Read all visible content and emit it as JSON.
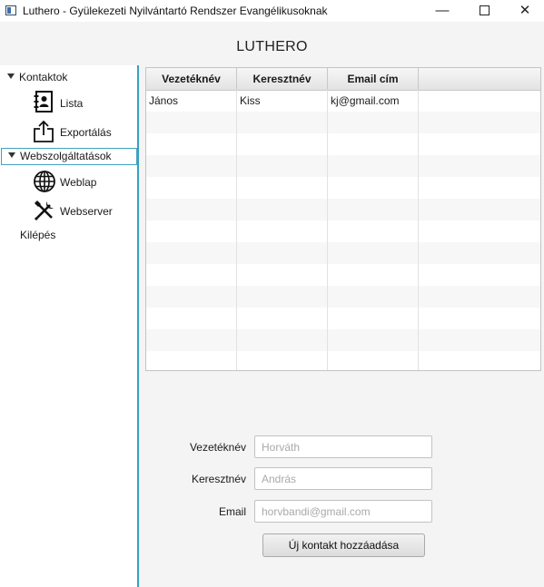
{
  "window": {
    "title": "Luthero - Gyülekezeti Nyilvántartó Rendszer Evangélikusoknak",
    "min_glyph": "—",
    "close_glyph": "✕"
  },
  "header": {
    "title": "LUTHERO"
  },
  "sidebar": {
    "groups": [
      {
        "label": "Kontaktok",
        "selected": false,
        "items": [
          {
            "label": "Lista",
            "icon": "address-book-icon"
          },
          {
            "label": "Exportálás",
            "icon": "export-icon"
          }
        ]
      },
      {
        "label": "Webszolgáltatások",
        "selected": true,
        "items": [
          {
            "label": "Weblap",
            "icon": "globe-icon"
          },
          {
            "label": "Webserver",
            "icon": "tools-icon"
          }
        ]
      }
    ],
    "exit_label": "Kilépés"
  },
  "table": {
    "columns": [
      "Vezetéknév",
      "Keresztnév",
      "Email cím"
    ],
    "rows": [
      [
        "János",
        "Kiss",
        "kj@gmail.com"
      ]
    ]
  },
  "form": {
    "lastname": {
      "label": "Vezetéknév",
      "placeholder": "Horváth",
      "value": ""
    },
    "firstname": {
      "label": "Keresztnév",
      "placeholder": "András",
      "value": ""
    },
    "email": {
      "label": "Email",
      "placeholder": "horvbandi@gmail.com",
      "value": ""
    },
    "submit_label": "Új kontakt hozzáadása"
  },
  "colors": {
    "sidebar_accent": "#3aa0c2",
    "background": "#f4f4f4"
  }
}
